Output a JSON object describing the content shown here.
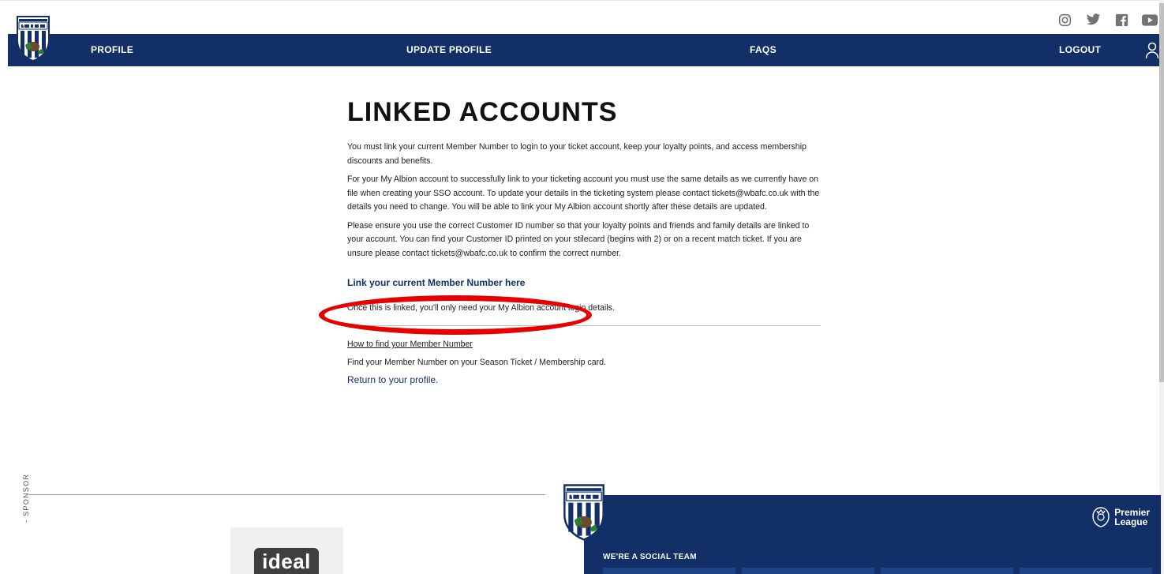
{
  "header": {
    "crest_alt": "West Bromwich Albion crest",
    "socials": [
      {
        "icon": "instagram-icon"
      },
      {
        "icon": "twitter-icon"
      },
      {
        "icon": "facebook-icon"
      },
      {
        "icon": "youtube-icon"
      }
    ]
  },
  "nav": {
    "profile": "PROFILE",
    "update_profile": "UPDATE PROFILE",
    "faqs": "FAQS",
    "logout": "LOGOUT"
  },
  "content": {
    "title": "LINKED ACCOUNTS",
    "para1": "You must link your current Member Number to login to your ticket account, keep your loyalty points, and access membership discounts and benefits.",
    "para2": "For your My Albion account to successfully link to your ticketing account you must use the same details as we currently have on file when creating your SSO account. To update your details in the ticketing system please contact tickets@wbafc.co.uk with the details you need to change. You will be able to link your My Albion account shortly after these details are updated.",
    "para3": "Please ensure you use the correct Customer ID number so that your loyalty points and friends and family details are linked to your account. You can find your Customer ID printed on your stilecard (begins with 2) or on a recent match ticket. If you are unsure please contact tickets@wbafc.co.uk to confirm the correct number.",
    "link_member": "Link your current Member Number here",
    "once_linked": "Once this is linked, you'll only need your My Albion account login details.",
    "how_to_find": "How to find your Member Number",
    "find_member": "Find your Member Number on your Season Ticket / Membership card.",
    "return_profile": "Return to your profile."
  },
  "footer": {
    "sponsor_label": "- SPONSOR",
    "sponsor_logo": "ideal",
    "social_team": "WE'RE A SOCIAL TEAM",
    "league_line1": "Premier",
    "league_line2": "League"
  },
  "colors": {
    "navy": "#122f67",
    "highlight": "#e60000"
  }
}
